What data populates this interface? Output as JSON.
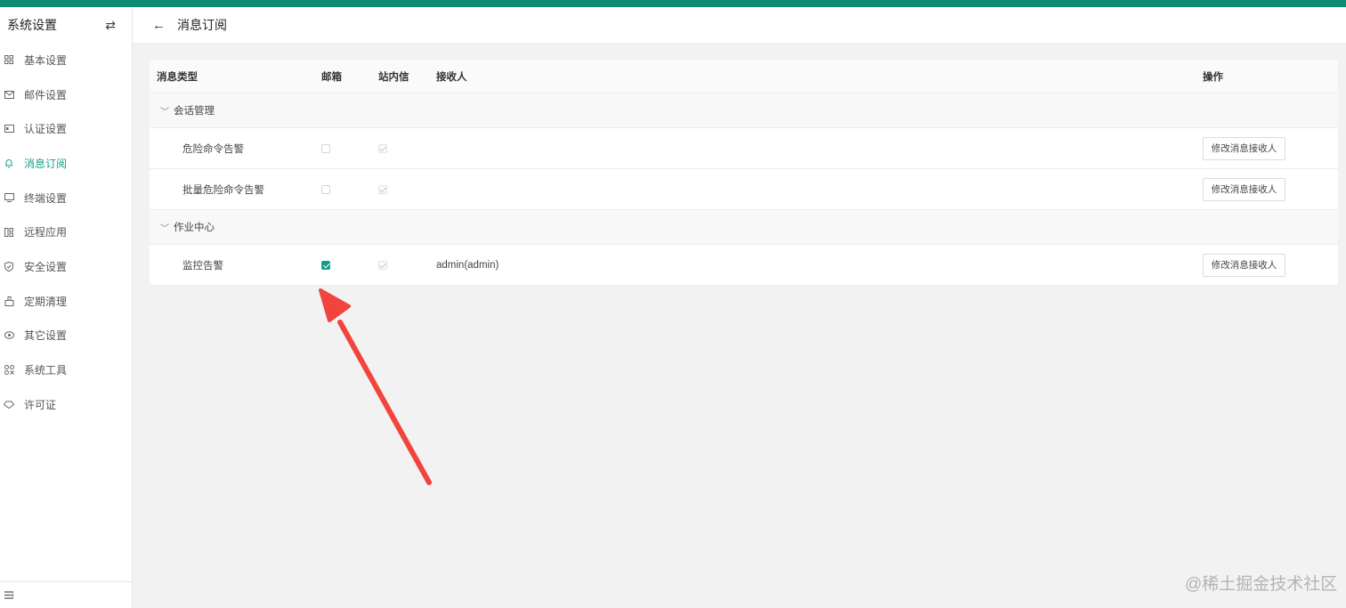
{
  "sidebar": {
    "title": "系统设置",
    "switch_icon": "⇄",
    "items": [
      {
        "label": "基本设置",
        "icon": "grid-icon"
      },
      {
        "label": "邮件设置",
        "icon": "mail-icon"
      },
      {
        "label": "认证设置",
        "icon": "id-card-icon"
      },
      {
        "label": "消息订阅",
        "icon": "bell-icon",
        "active": true
      },
      {
        "label": "终端设置",
        "icon": "monitor-icon"
      },
      {
        "label": "远程应用",
        "icon": "apps-icon"
      },
      {
        "label": "安全设置",
        "icon": "shield-icon"
      },
      {
        "label": "定期清理",
        "icon": "broom-icon"
      },
      {
        "label": "其它设置",
        "icon": "eye-icon"
      },
      {
        "label": "系统工具",
        "icon": "tools-icon"
      },
      {
        "label": "许可证",
        "icon": "license-icon"
      }
    ],
    "footer_icon": "collapse-menu-icon"
  },
  "header": {
    "back_icon": "←",
    "title": "消息订阅"
  },
  "table": {
    "columns": {
      "type": "消息类型",
      "mail": "邮箱",
      "site": "站内信",
      "receivers": "接收人",
      "ops": "操作"
    },
    "groups": [
      {
        "name": "会话管理",
        "items": [
          {
            "name": "危险命令告警",
            "mail": false,
            "site": true,
            "receivers": "",
            "button": "修改消息接收人"
          },
          {
            "name": "批量危险命令告警",
            "mail": false,
            "site": true,
            "receivers": "",
            "button": "修改消息接收人"
          }
        ]
      },
      {
        "name": "作业中心",
        "items": [
          {
            "name": "监控告警",
            "mail": true,
            "site": true,
            "receivers": "admin(admin)",
            "button": "修改消息接收人"
          }
        ]
      }
    ]
  },
  "annotation": {
    "arrow_color": "#f0443c"
  },
  "watermark": "@稀土掘金技术社区",
  "colors": {
    "accent": "#13a08a",
    "topbar": "#0d8a73"
  }
}
